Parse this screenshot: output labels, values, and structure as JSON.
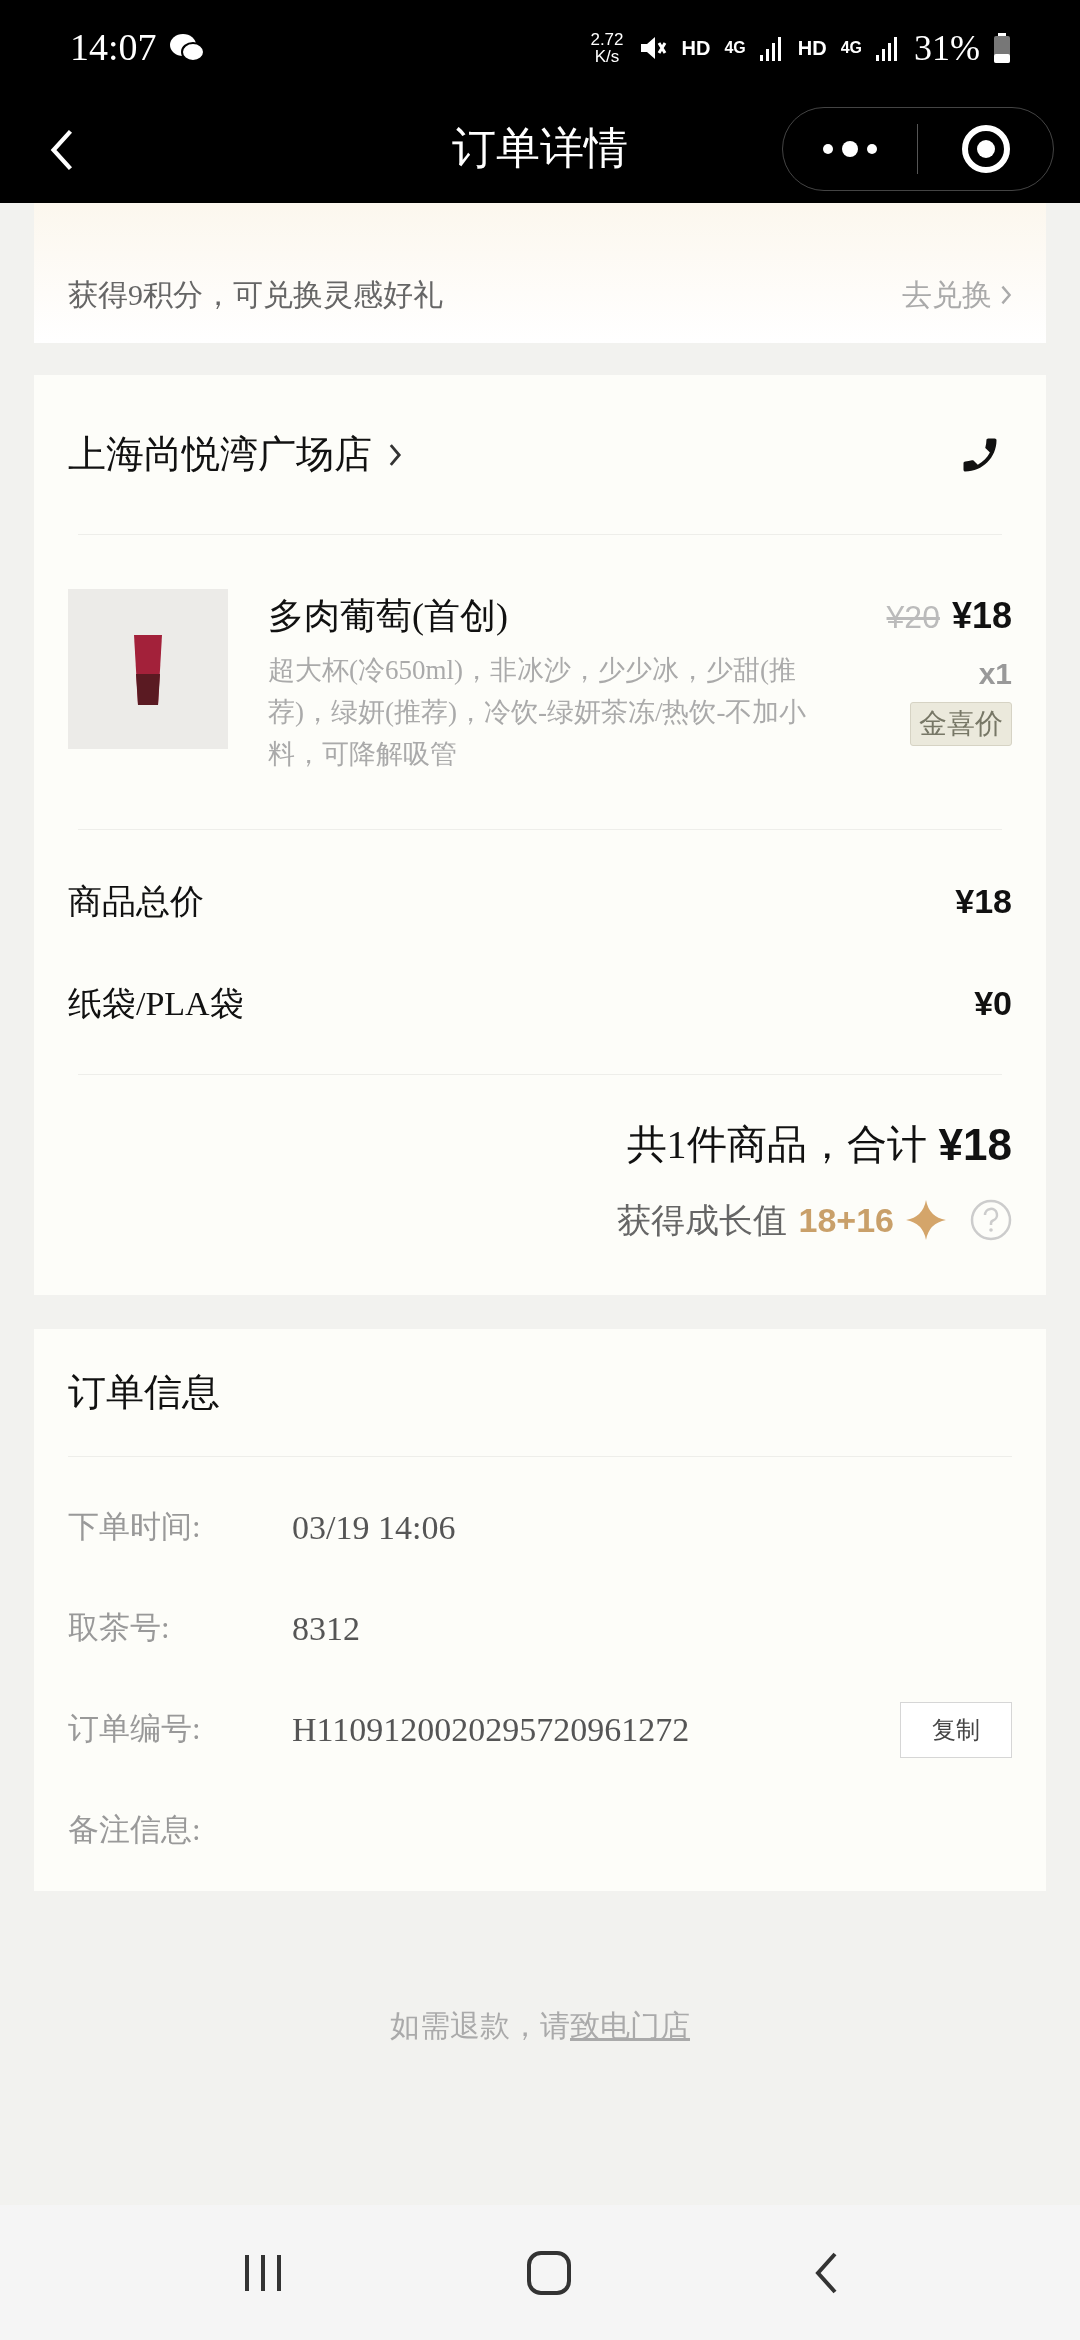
{
  "status_bar": {
    "time": "14:07",
    "speed": "2.72",
    "speed_unit": "K/s",
    "hd_1": "HD",
    "net_1": "4G",
    "hd_2": "HD",
    "net_2": "4G",
    "battery": "31%"
  },
  "nav": {
    "title": "订单详情"
  },
  "points": {
    "text": "获得9积分，可兑换灵感好礼",
    "link": "去兑换"
  },
  "store": {
    "name": "上海尚悦湾广场店"
  },
  "items": [
    {
      "name": "多肉葡萄(首创)",
      "options": "超大杯(冷650ml)，非冰沙，少少冰，少甜(推荐)，绿妍(推荐)，冷饮-绿妍茶冻/热饮-不加小料，可降解吸管",
      "original_price": "¥20",
      "price": "¥18",
      "quantity": "x1",
      "tag": "金喜价"
    }
  ],
  "fees": [
    {
      "label": "商品总价",
      "value": "¥18"
    },
    {
      "label": "纸袋/PLA袋",
      "value": "¥0"
    }
  ],
  "summary": {
    "text": "共1件商品，合计",
    "total": "¥18",
    "growth_label": "获得成长值",
    "growth_value": "18+16"
  },
  "order_info": {
    "title": "订单信息",
    "rows": [
      {
        "label": "下单时间:",
        "value": "03/19 14:06"
      },
      {
        "label": "取茶号:",
        "value": "8312"
      },
      {
        "label": "订单编号:",
        "value": "H1109120020295720961272",
        "action": "复制"
      },
      {
        "label": "备注信息:"
      }
    ]
  },
  "footer": {
    "text": "如需退款，请",
    "link": "致电门店"
  }
}
